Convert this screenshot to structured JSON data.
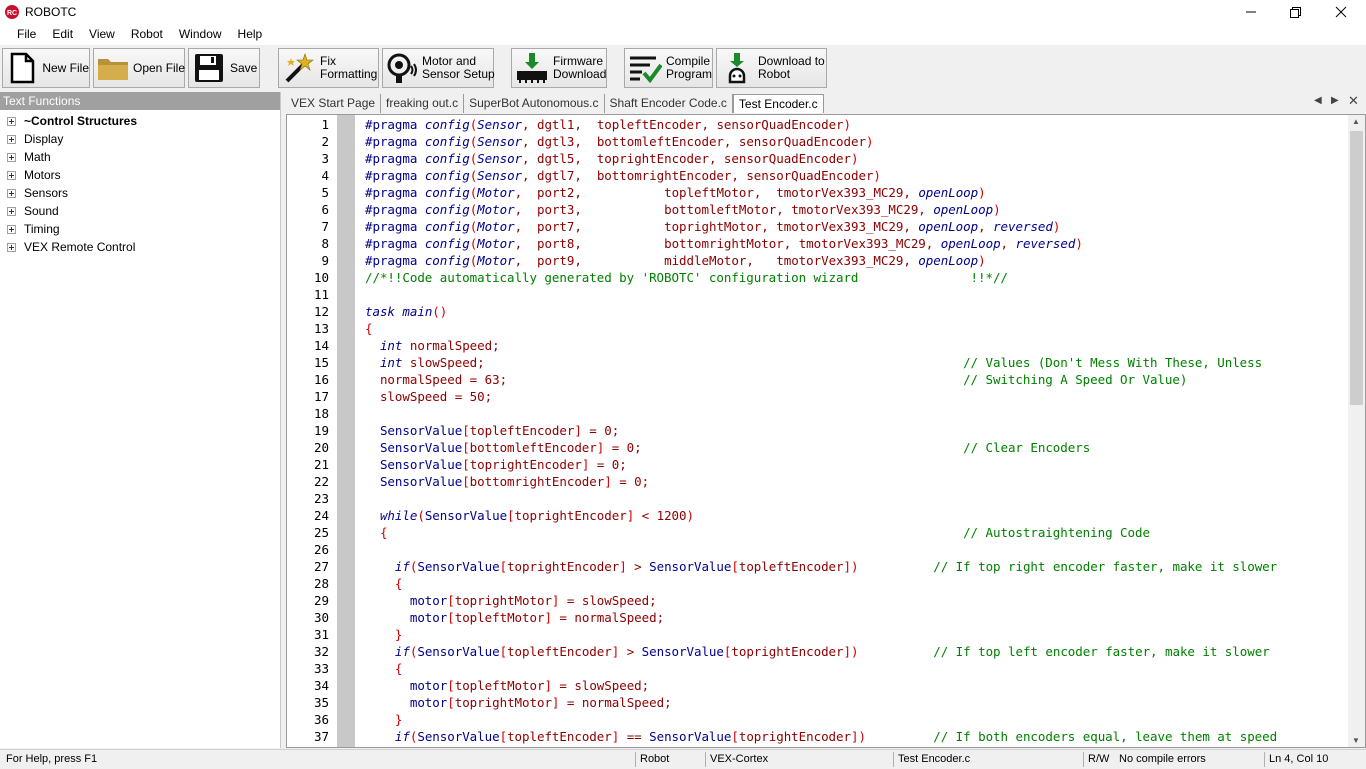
{
  "window": {
    "title": "ROBOTC",
    "minimize_icon": "minimize-icon",
    "maximize_icon": "restore-icon",
    "close_icon": "close-icon"
  },
  "menu": [
    "File",
    "Edit",
    "View",
    "Robot",
    "Window",
    "Help"
  ],
  "toolbar": {
    "new_file": "New File",
    "open_file": "Open File",
    "save": "Save",
    "fix_formatting": "Fix\nFormatting",
    "motor_sensor_setup": "Motor and\nSensor Setup",
    "firmware_download": "Firmware\nDownload",
    "compile_program": "Compile\nProgram",
    "download_to_robot": "Download to\nRobot"
  },
  "left_panel": {
    "header": "Text Functions",
    "items": [
      "~Control Structures",
      "Display",
      "Math",
      "Motors",
      "Sensors",
      "Sound",
      "Timing",
      "VEX Remote Control"
    ]
  },
  "tabs": [
    "VEX Start Page",
    "freaking out.c",
    "SuperBot Autonomous.c",
    "Shaft Encoder Code.c",
    "Test Encoder.c"
  ],
  "active_tab": "Test Encoder.c",
  "code_lines": [
    "#pragma config(Sensor, dgtl1,  topleftEncoder, sensorQuadEncoder)",
    "#pragma config(Sensor, dgtl3,  bottomleftEncoder, sensorQuadEncoder)",
    "#pragma config(Sensor, dgtl5,  toprightEncoder, sensorQuadEncoder)",
    "#pragma config(Sensor, dgtl7,  bottomrightEncoder, sensorQuadEncoder)",
    "#pragma config(Motor,  port2,           topleftMotor,  tmotorVex393_MC29, openLoop)",
    "#pragma config(Motor,  port3,           bottomleftMotor, tmotorVex393_MC29, openLoop)",
    "#pragma config(Motor,  port7,           toprightMotor, tmotorVex393_MC29, openLoop, reversed)",
    "#pragma config(Motor,  port8,           bottomrightMotor, tmotorVex393_MC29, openLoop, reversed)",
    "#pragma config(Motor,  port9,           middleMotor,   tmotorVex393_MC29, openLoop)",
    "//*!!Code automatically generated by 'ROBOTC' configuration wizard               !!*//",
    "",
    "task main()",
    "{",
    "  int normalSpeed;",
    "  int slowSpeed;                                                                // Values (Don't Mess With These, Unless",
    "  normalSpeed = 63;                                                             // Switching A Speed Or Value)",
    "  slowSpeed = 50;",
    "",
    "  SensorValue[topleftEncoder] = 0;",
    "  SensorValue[bottomleftEncoder] = 0;                                           // Clear Encoders",
    "  SensorValue[toprightEncoder] = 0;",
    "  SensorValue[bottomrightEncoder] = 0;",
    "",
    "  while(SensorValue[toprightEncoder] < 1200)",
    "  {                                                                             // Autostraightening Code",
    "",
    "    if(SensorValue[toprightEncoder] > SensorValue[topleftEncoder])          // If top right encoder faster, make it slower",
    "    {",
    "      motor[toprightMotor] = slowSpeed;",
    "      motor[topleftMotor] = normalSpeed;",
    "    }",
    "    if(SensorValue[topleftEncoder] > SensorValue[toprightEncoder])          // If top left encoder faster, make it slower",
    "    {",
    "      motor[topleftMotor] = slowSpeed;",
    "      motor[toprightMotor] = normalSpeed;",
    "    }",
    "    if(SensorValue[topleftEncoder] == SensorValue[toprightEncoder])         // If both encoders equal, leave them at speed"
  ],
  "status": {
    "help": "For Help, press F1",
    "robot": "Robot",
    "platform": "VEX-Cortex",
    "file": "Test Encoder.c",
    "rw": "R/W",
    "compile": "No compile errors",
    "position": "Ln 4, Col 10"
  },
  "colors": {
    "keyword": "#00008b",
    "identifier": "#8b0000",
    "comment": "#008000",
    "bracket": "#cc0000"
  }
}
